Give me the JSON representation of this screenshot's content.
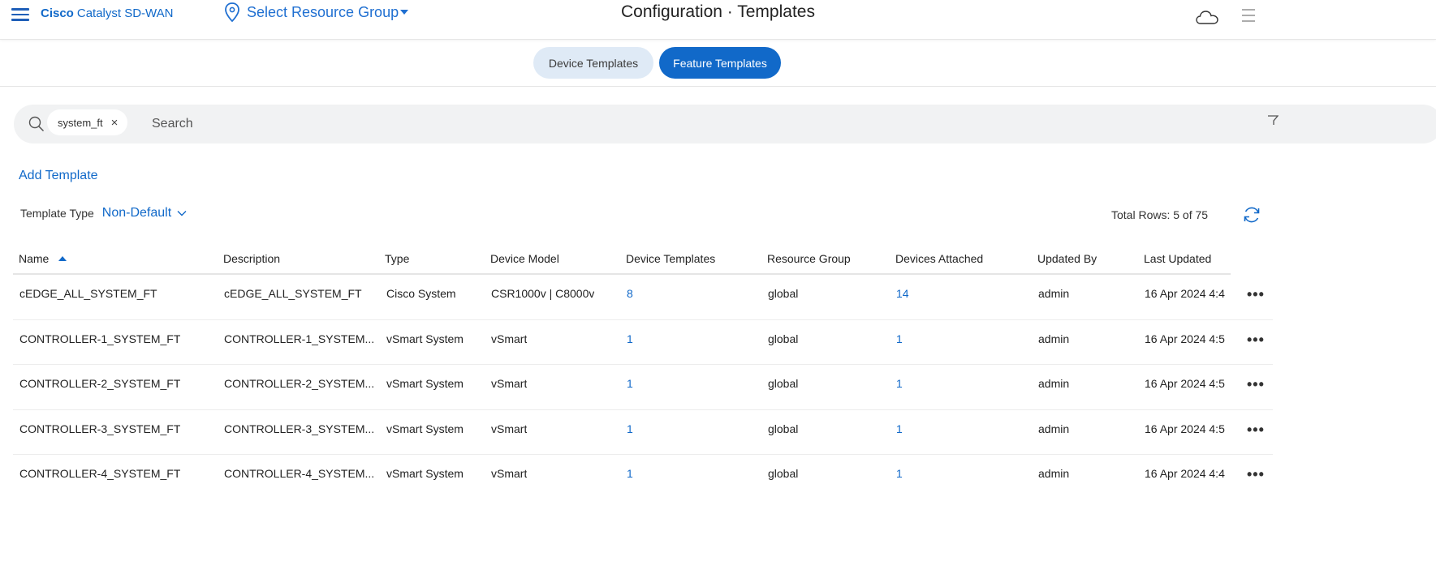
{
  "header": {
    "brand_bold": "Cisco",
    "brand_rest": "Catalyst SD-WAN",
    "resource_group": "Select Resource Group",
    "title_left": "Configuration",
    "title_sep": "·",
    "title_right": "Templates"
  },
  "tabs": [
    {
      "label": "Device Templates",
      "active": false
    },
    {
      "label": "Feature Templates",
      "active": true
    }
  ],
  "search": {
    "chip": "system_ft",
    "chip_close": "×",
    "placeholder": "Search"
  },
  "actions": {
    "add_template": "Add Template"
  },
  "filter": {
    "type_label": "Template Type",
    "type_value": "Non-Default"
  },
  "total_rows": "Total Rows: 5 of 75",
  "table": {
    "headers": [
      "Name",
      "Description",
      "Type",
      "Device Model",
      "Device Templates",
      "Resource Group",
      "Devices Attached",
      "Updated By",
      "Last Updated"
    ],
    "rows": [
      {
        "name": "cEDGE_ALL_SYSTEM_FT",
        "description": "cEDGE_ALL_SYSTEM_FT",
        "type": "Cisco System",
        "device_model": "CSR1000v | C8000v",
        "device_templates": "8",
        "resource_group": "global",
        "devices_attached": "14",
        "updated_by": "admin",
        "last_updated": "16 Apr 2024 4:4"
      },
      {
        "name": "CONTROLLER-1_SYSTEM_FT",
        "description": "CONTROLLER-1_SYSTEM...",
        "type": "vSmart System",
        "device_model": "vSmart",
        "device_templates": "1",
        "resource_group": "global",
        "devices_attached": "1",
        "updated_by": "admin",
        "last_updated": "16 Apr 2024 4:5"
      },
      {
        "name": "CONTROLLER-2_SYSTEM_FT",
        "description": "CONTROLLER-2_SYSTEM...",
        "type": "vSmart System",
        "device_model": "vSmart",
        "device_templates": "1",
        "resource_group": "global",
        "devices_attached": "1",
        "updated_by": "admin",
        "last_updated": "16 Apr 2024 4:5"
      },
      {
        "name": "CONTROLLER-3_SYSTEM_FT",
        "description": "CONTROLLER-3_SYSTEM...",
        "type": "vSmart System",
        "device_model": "vSmart",
        "device_templates": "1",
        "resource_group": "global",
        "devices_attached": "1",
        "updated_by": "admin",
        "last_updated": "16 Apr 2024 4:5"
      },
      {
        "name": "CONTROLLER-4_SYSTEM_FT",
        "description": "CONTROLLER-4_SYSTEM...",
        "type": "vSmart System",
        "device_model": "vSmart",
        "device_templates": "1",
        "resource_group": "global",
        "devices_attached": "1",
        "updated_by": "admin",
        "last_updated": "16 Apr 2024 4:4"
      }
    ],
    "row_more": "•••"
  },
  "colors": {
    "accent": "#1169c9",
    "tab_inactive_bg": "#dfeaf6",
    "search_bg": "#f1f2f3"
  }
}
